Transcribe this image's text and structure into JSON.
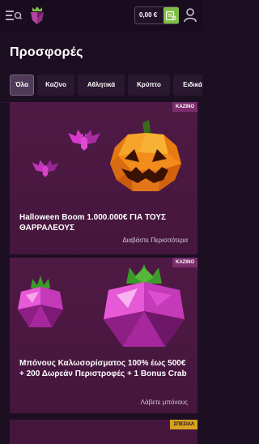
{
  "header": {
    "balance": "0,00 €"
  },
  "page_title": "Προσφορές",
  "tabs": [
    {
      "label": "Όλα"
    },
    {
      "label": "Καζίνο"
    },
    {
      "label": "Αθλητικά"
    },
    {
      "label": "Κρύπτο"
    },
    {
      "label": "Ειδικά"
    }
  ],
  "promos": [
    {
      "badge": "ΚΑΖΙΝΟ",
      "title": "Halloween Boom 1.000.000€ ΓΙΑ ΤΟΥΣ ΘΑΡΡΑΛΕΟΥΣ",
      "link": "Διαβάστε Περισσότερα"
    },
    {
      "badge": "ΚΑΖΙΝΟ",
      "title": "Μπόνους Καλωσορίσματος 100% έως 500€ + 200 Δωρεάν Περιστροφές + 1 Bonus Crab",
      "link": "Λάβετε μπόνους"
    },
    {
      "badge": "ΣΠΕΣΙΑΛ"
    }
  ],
  "colors": {
    "background": "#1d0f22",
    "card": "#4a1840",
    "badge_casino": "#7b2d6c",
    "badge_special": "#d9a321",
    "wallet_button": "#7ec043"
  },
  "icons": [
    "menu-icon",
    "logo-icon",
    "wallet-icon",
    "user-icon",
    "pumpkin-icon",
    "bat-icon",
    "gem-icon"
  ]
}
